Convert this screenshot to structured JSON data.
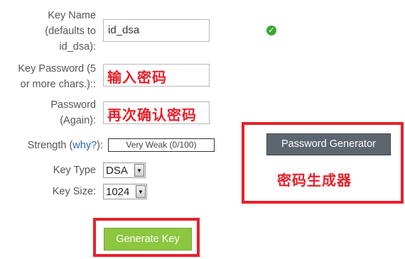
{
  "form": {
    "key_name": {
      "label_lines": [
        "Key Name",
        "(defaults to",
        "id_dsa):"
      ],
      "value": "id_dsa"
    },
    "key_password": {
      "label_lines": [
        "Key Password (5",
        "or more chars.)::"
      ],
      "annotation": "输入密码"
    },
    "password_again": {
      "label_lines": [
        "Password",
        "(Again):"
      ],
      "annotation": "再次确认密码"
    },
    "strength": {
      "label": "Strength (",
      "link": "why?",
      "label_end": "):",
      "value": "Very Weak (0/100)"
    },
    "key_type": {
      "label": "Key Type",
      "value": "DSA"
    },
    "key_size": {
      "label": "Key Size:",
      "value": "1024"
    },
    "password_generator_button": "Password Generator",
    "password_generator_annotation": "密码生成器",
    "generate_key_button": "Generate Key"
  },
  "colors": {
    "annotation_red": "#e8202a",
    "generate_green": "#8dc63f",
    "generator_gray": "#5d6670",
    "check_green": "#3aa832"
  },
  "icons": {
    "valid": "check-circle-icon",
    "dropdown": "triangle-down-icon"
  }
}
